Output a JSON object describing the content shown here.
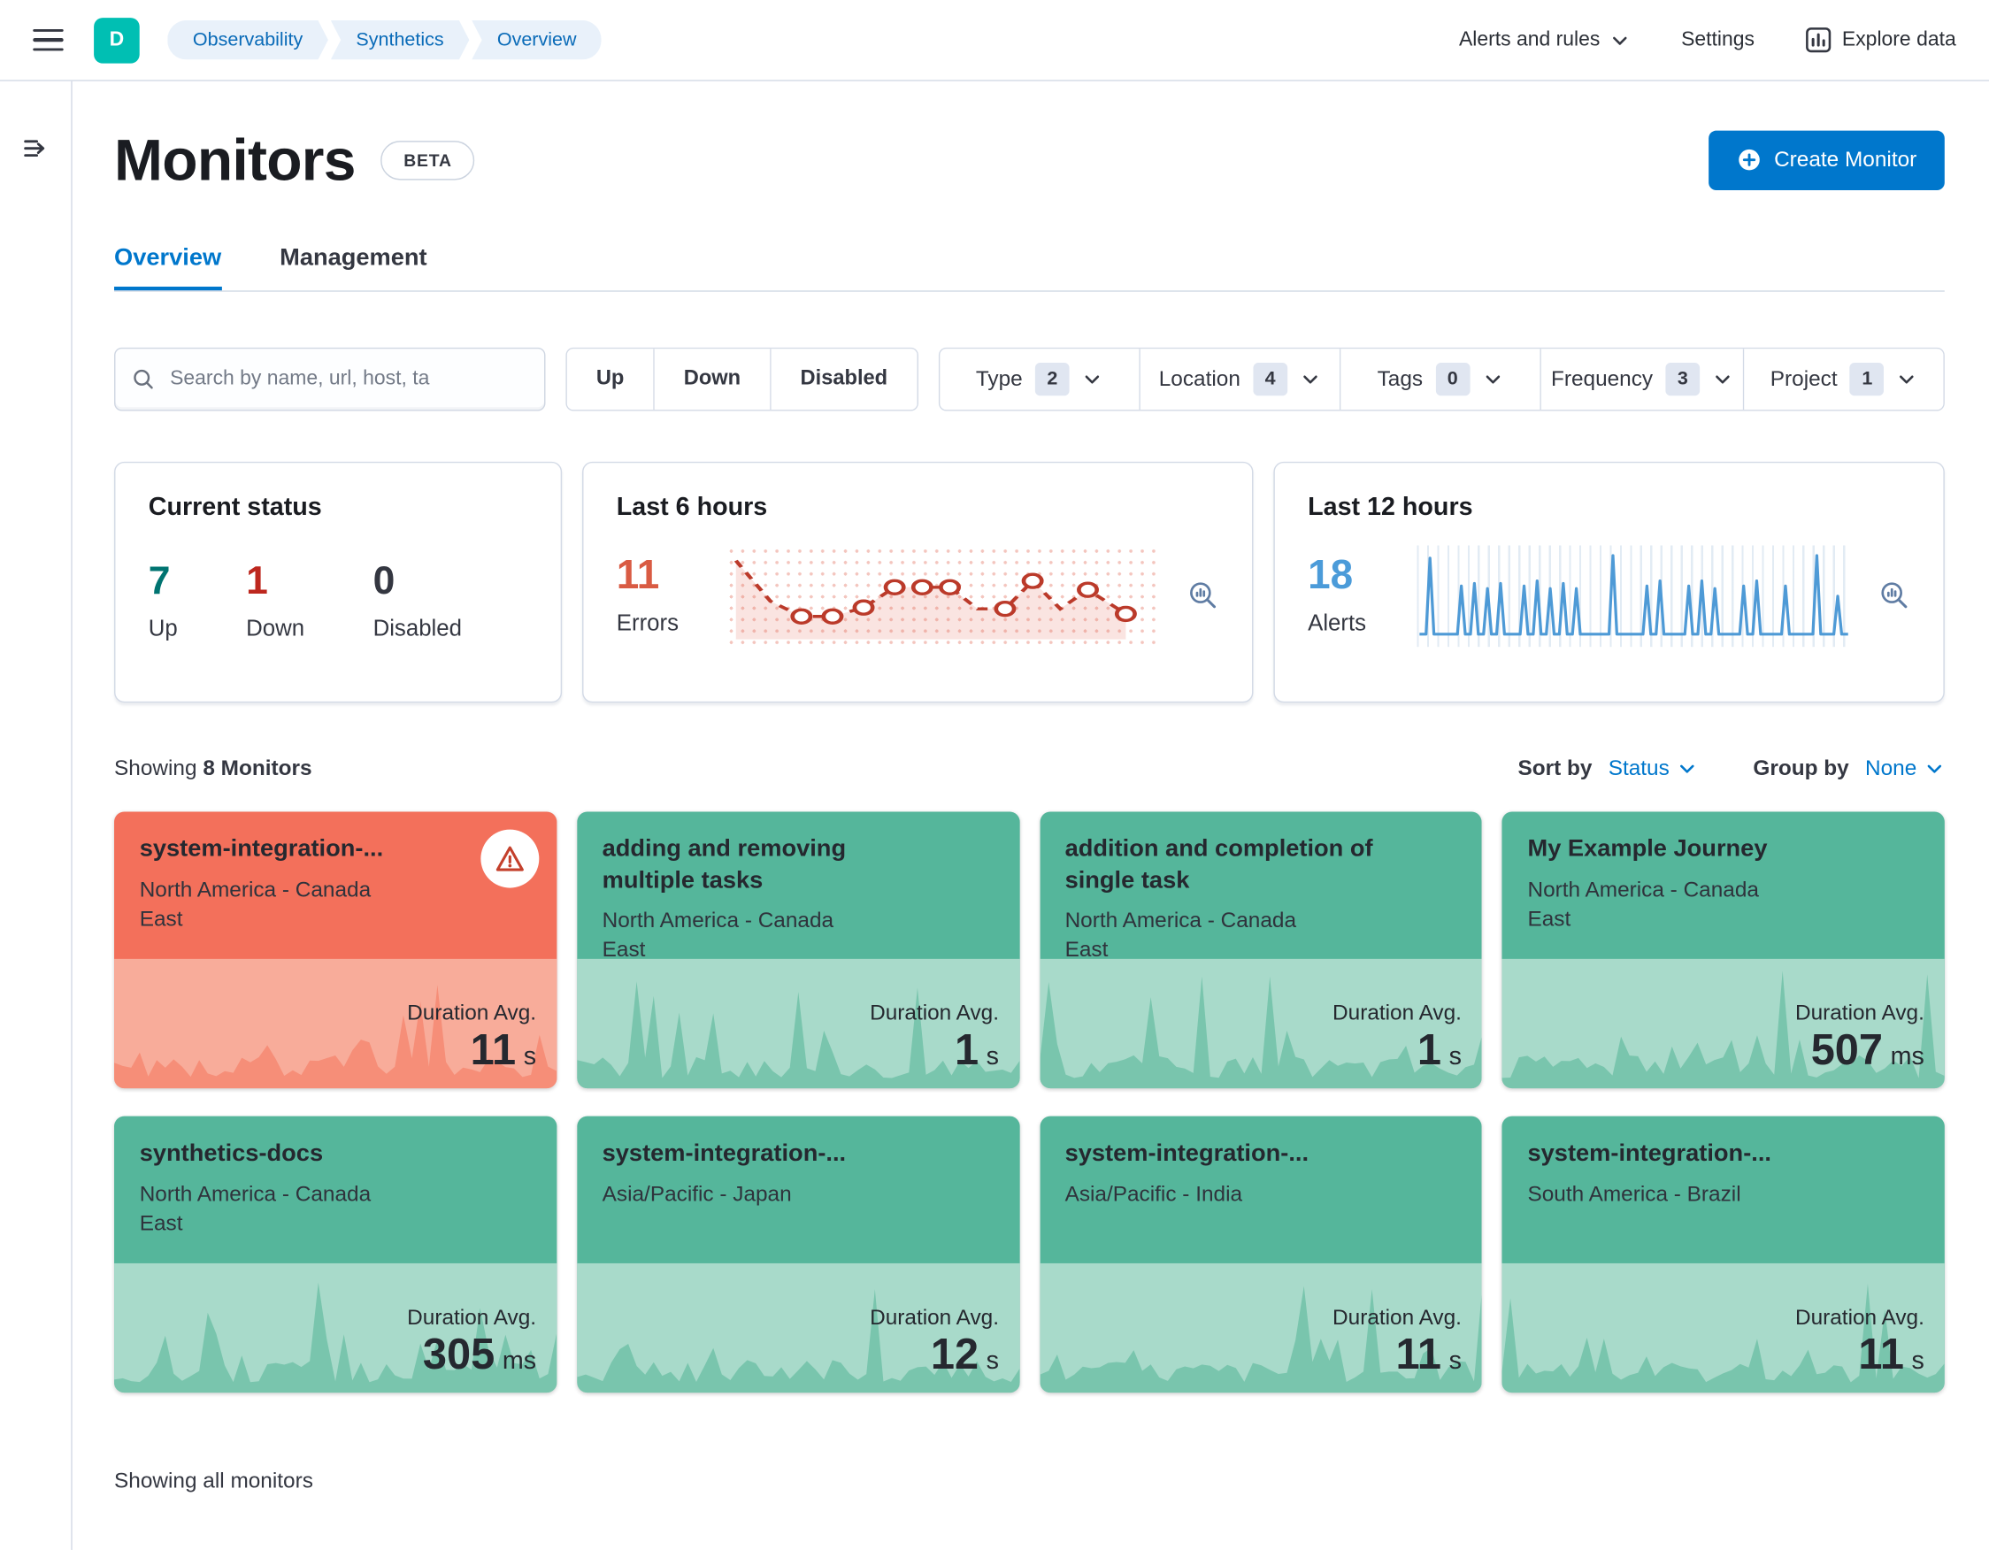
{
  "header": {
    "logo_letter": "D",
    "breadcrumbs": [
      "Observability",
      "Synthetics",
      "Overview"
    ],
    "alerts_menu": "Alerts and rules",
    "settings": "Settings",
    "explore": "Explore data"
  },
  "page": {
    "title": "Monitors",
    "beta_badge": "BETA",
    "create_button": "Create Monitor",
    "tabs": [
      {
        "label": "Overview",
        "active": true
      },
      {
        "label": "Management",
        "active": false
      }
    ],
    "search_placeholder": "Search by name, url, host, ta",
    "status_filters": [
      "Up",
      "Down",
      "Disabled"
    ],
    "filters": [
      {
        "label": "Type",
        "count": "2"
      },
      {
        "label": "Location",
        "count": "4"
      },
      {
        "label": "Tags",
        "count": "0"
      },
      {
        "label": "Frequency",
        "count": "3"
      },
      {
        "label": "Project",
        "count": "1"
      }
    ],
    "showing_prefix": "Showing",
    "showing_bold": "8 Monitors",
    "sort_by_label": "Sort by",
    "sort_by_value": "Status",
    "group_by_label": "Group by",
    "group_by_value": "None",
    "duration_label": "Duration Avg.",
    "footer_text": "Showing all monitors"
  },
  "stats": {
    "current_status": {
      "title": "Current status",
      "items": [
        {
          "value": "7",
          "label": "Up",
          "color": "#007471"
        },
        {
          "value": "1",
          "label": "Down",
          "color": "#BD271E"
        },
        {
          "value": "0",
          "label": "Disabled",
          "color": "#343741"
        }
      ]
    },
    "last6": {
      "title": "Last 6 hours",
      "value": "11",
      "label": "Errors",
      "color": "#D95B43"
    },
    "last12": {
      "title": "Last 12 hours",
      "value": "18",
      "label": "Alerts",
      "color": "#4B9BD9"
    }
  },
  "monitors": [
    {
      "name": "system-integration-...",
      "location": "North America - Canada East",
      "duration_value": "11",
      "duration_unit": "s",
      "status": "down"
    },
    {
      "name": "adding and removing multiple tasks",
      "location": "North America - Canada East",
      "duration_value": "1",
      "duration_unit": "s",
      "status": "up"
    },
    {
      "name": "addition and completion of single task",
      "location": "North America - Canada East",
      "duration_value": "1",
      "duration_unit": "s",
      "status": "up"
    },
    {
      "name": "My Example Journey",
      "location": "North America - Canada East",
      "duration_value": "507",
      "duration_unit": "ms",
      "status": "up"
    },
    {
      "name": "synthetics-docs",
      "location": "North America - Canada East",
      "duration_value": "305",
      "duration_unit": "ms",
      "status": "up"
    },
    {
      "name": "system-integration-...",
      "location": "Asia/Pacific - Japan",
      "duration_value": "12",
      "duration_unit": "s",
      "status": "up"
    },
    {
      "name": "system-integration-...",
      "location": "Asia/Pacific - India",
      "duration_value": "11",
      "duration_unit": "s",
      "status": "up"
    },
    {
      "name": "system-integration-...",
      "location": "South America - Brazil",
      "duration_value": "11",
      "duration_unit": "s",
      "status": "up"
    }
  ],
  "icons": {
    "hamburger": "hamburger-menu-icon",
    "expand_sidebar": "expand-sidebar-icon",
    "search": "search-icon",
    "chevron": "chevron-down-icon",
    "inspect": "inspect-chart-icon",
    "explore": "explore-data-icon",
    "plus": "plus-in-circle-icon",
    "warning": "warning-icon"
  },
  "colors": {
    "accent_blue": "#0077CC",
    "brand_teal": "#00BFB3",
    "card_up_green": "#55B69B",
    "card_down_red": "#F3705B"
  }
}
